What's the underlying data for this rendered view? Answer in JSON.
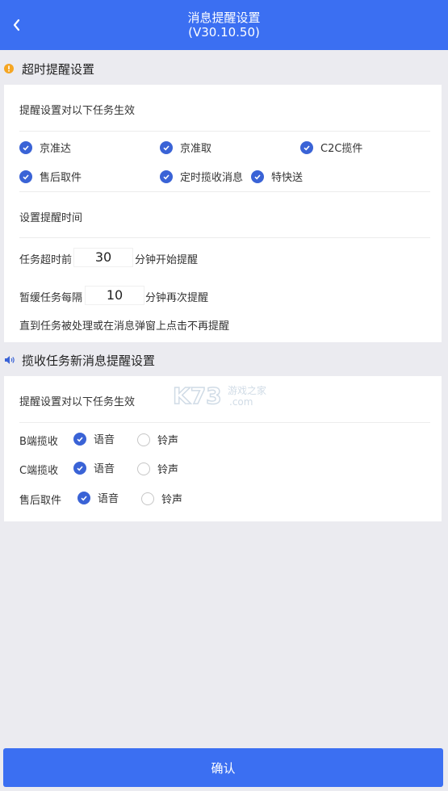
{
  "header": {
    "title": "消息提醒设置",
    "version": "(V30.10.50)"
  },
  "timeout_section": {
    "title": "超时提醒设置",
    "applies_label": "提醒设置对以下任务生效",
    "tasks": [
      {
        "label": "京准达",
        "checked": true
      },
      {
        "label": "京准取",
        "checked": true
      },
      {
        "label": "C2C揽件",
        "checked": true
      },
      {
        "label": "售后取件",
        "checked": true
      },
      {
        "label": "定时揽收消息",
        "checked": true
      },
      {
        "label": "特快送",
        "checked": true
      }
    ],
    "time_label": "设置提醒时间",
    "before_prefix": "任务超时前",
    "before_value": "30",
    "before_suffix": "分钟开始提醒",
    "snooze_prefix": "暂缓任务每隔",
    "snooze_value": "10",
    "snooze_suffix": "分钟再次提醒",
    "note": "直到任务被处理或在消息弹窗上点击不再提醒"
  },
  "pickup_section": {
    "title": "揽收任务新消息提醒设置",
    "applies_label": "提醒设置对以下任务生效",
    "rows": [
      {
        "label": "B端揽收",
        "voice": "语音",
        "ring": "铃声",
        "selected": "voice"
      },
      {
        "label": "C端揽收",
        "voice": "语音",
        "ring": "铃声",
        "selected": "voice"
      },
      {
        "label": "售后取件",
        "voice": "语音",
        "ring": "铃声",
        "selected": "voice"
      }
    ]
  },
  "watermark": {
    "text": "K73",
    "sub": "游戏之家",
    "domain": ".com"
  },
  "footer": {
    "confirm_label": "确认"
  },
  "colors": {
    "primary": "#3b6ff2",
    "check": "#3a63d6",
    "warning": "#f5a623"
  }
}
